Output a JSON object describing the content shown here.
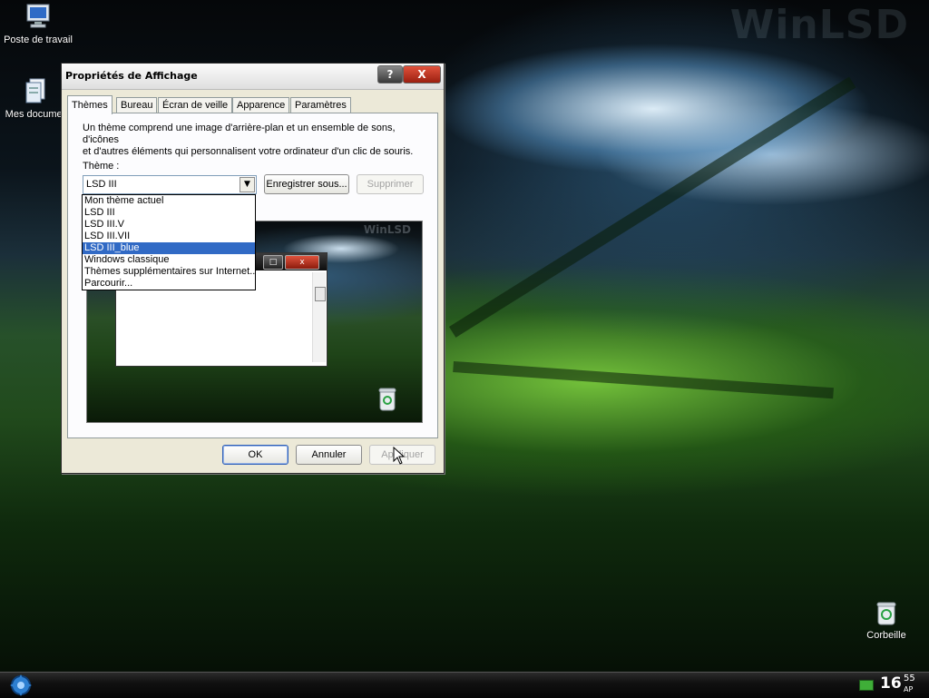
{
  "desktop": {
    "watermark": "WinLSD",
    "icons": [
      {
        "label": "Poste de travail",
        "icon": "computer-icon"
      },
      {
        "label": "Mes documer",
        "icon": "documents-icon"
      },
      {
        "label": "Corbeille",
        "icon": "recycle-bin-icon"
      }
    ]
  },
  "dialog": {
    "title": "Propriétés de Affichage",
    "help_label": "?",
    "close_label": "X",
    "tabs": [
      {
        "label": "Thèmes",
        "active": true
      },
      {
        "label": "Bureau",
        "active": false
      },
      {
        "label": "Écran de veille",
        "active": false
      },
      {
        "label": "Apparence",
        "active": false
      },
      {
        "label": "Paramètres",
        "active": false
      }
    ],
    "description_line1": "Un thème comprend une image d'arrière-plan et un ensemble de sons, d'icônes",
    "description_line2": "et d'autres éléments qui personnalisent votre ordinateur d'un clic de souris.",
    "theme_label": "Thème :",
    "theme_value": "LSD III",
    "save_as_label": "Enregistrer sous...",
    "delete_label": "Supprimer",
    "theme_options": [
      {
        "label": "Mon thème actuel",
        "selected": false
      },
      {
        "label": "LSD III",
        "selected": false
      },
      {
        "label": "LSD III.V",
        "selected": false
      },
      {
        "label": "LSD III.VII",
        "selected": false
      },
      {
        "label": "LSD III_blue",
        "selected": true
      },
      {
        "label": "Windows classique",
        "selected": false
      },
      {
        "label": "Thèmes supplémentaires sur Internet...",
        "selected": false
      },
      {
        "label": "Parcourir...",
        "selected": false
      }
    ],
    "preview": {
      "watermark": "WinLSD"
    },
    "ok_label": "OK",
    "cancel_label": "Annuler",
    "apply_label": "Appliquer"
  },
  "taskbar": {
    "clock_hour": "16",
    "clock_minute": "55",
    "clock_ampm": "AP"
  },
  "colors": {
    "selection": "#316ac5",
    "close_button": "#c0392b"
  }
}
